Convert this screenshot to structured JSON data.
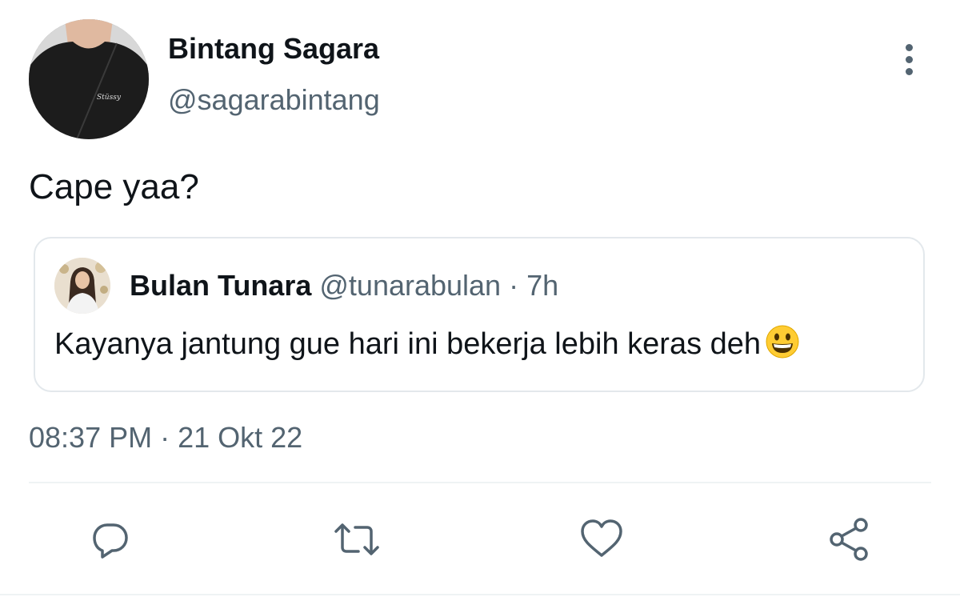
{
  "tweet": {
    "author": {
      "display_name": "Bintang Sagara",
      "handle": "@sagarabintang"
    },
    "text": "Cape yaa?",
    "timestamp": "08:37 PM · 21 Okt 22"
  },
  "quoted_tweet": {
    "author": {
      "display_name": "Bulan Tunara",
      "handle": "@tunarabulan"
    },
    "meta": "@tunarabulan · 7h",
    "text": "Kayanya jantung gue hari ini bekerja lebih keras deh"
  },
  "icons": {
    "more": "more-vertical-icon",
    "reply": "reply-icon",
    "retweet": "retweet-icon",
    "like": "heart-icon",
    "share": "share-icon",
    "emoji": "grinning-face-emoji"
  },
  "colors": {
    "text_primary": "#0f1419",
    "text_secondary": "#536471",
    "border": "#e3e8ec",
    "icon": "#536471"
  }
}
